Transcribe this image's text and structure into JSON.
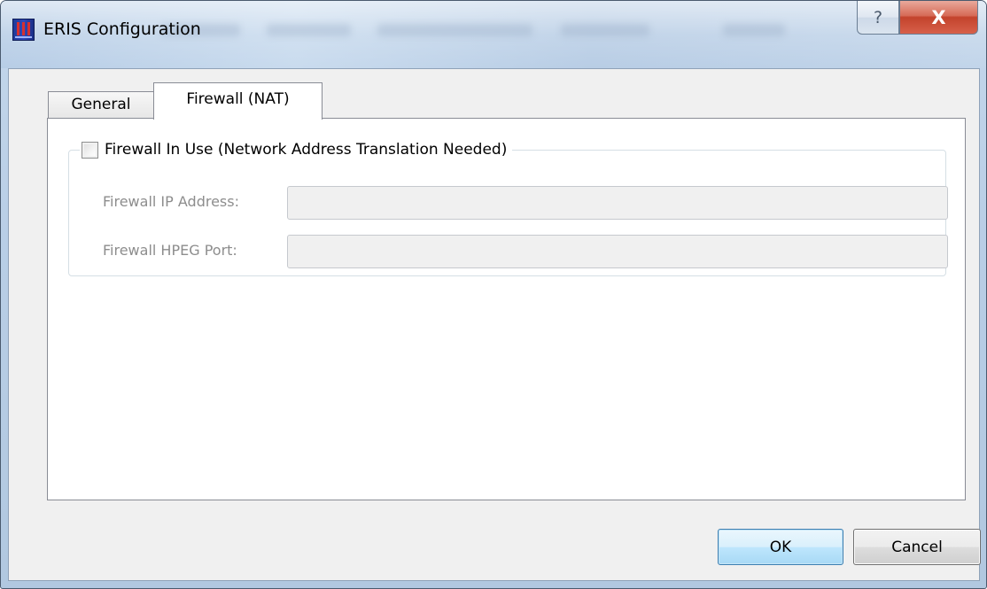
{
  "window": {
    "title": "ERIS Configuration",
    "help_label": "?",
    "close_label": "X"
  },
  "tabs": [
    {
      "label": "General",
      "active": false
    },
    {
      "label": "Firewall (NAT)",
      "active": true
    }
  ],
  "firewall": {
    "checkbox_label": "Firewall In Use (Network Address Translation Needed)",
    "checked": false,
    "fields": [
      {
        "label": "Firewall IP Address:",
        "value": ""
      },
      {
        "label": "Firewall HPEG Port:",
        "value": ""
      }
    ]
  },
  "buttons": {
    "ok_label": "OK",
    "cancel_label": "Cancel"
  }
}
